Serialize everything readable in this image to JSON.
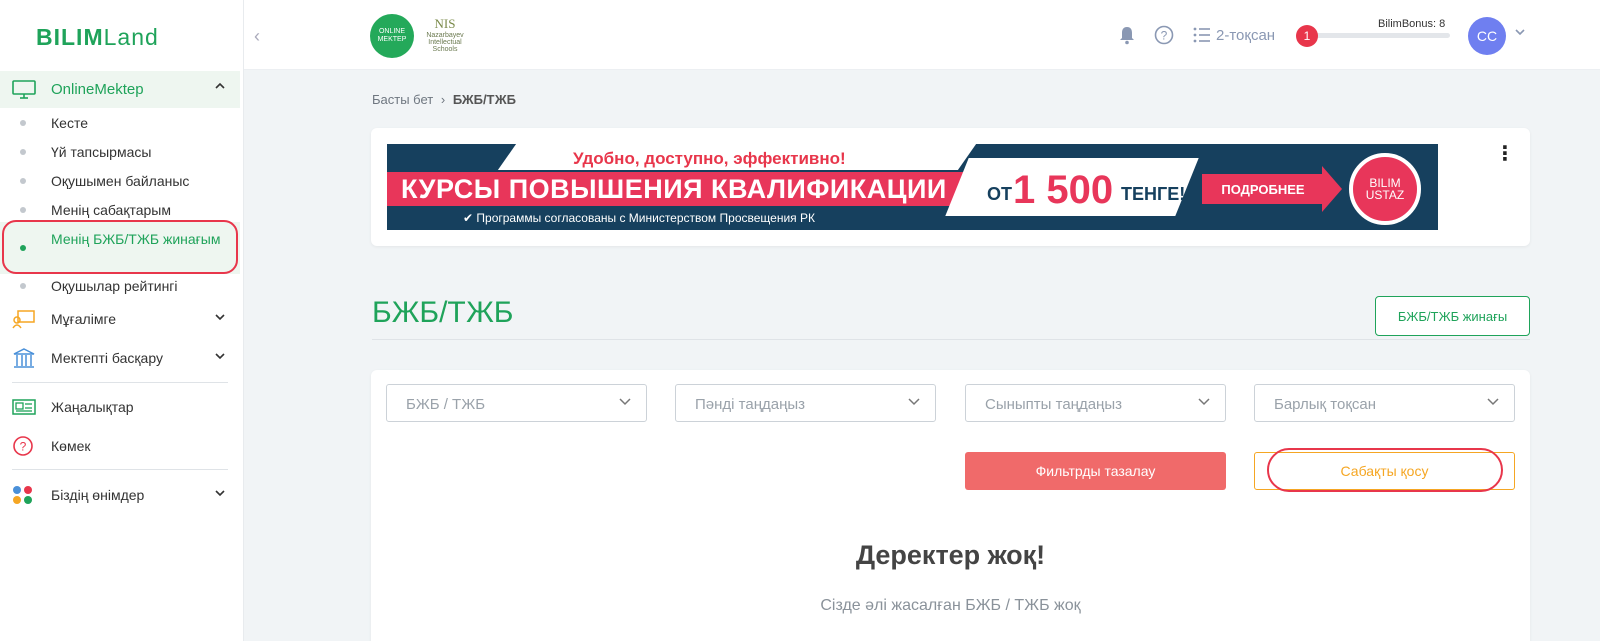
{
  "sidebar": {
    "logo_bold": "BILIM",
    "logo_thin": "Land",
    "collapse": "‹",
    "group_label": "OnlineMektep",
    "sub_items": [
      "Кесте",
      "Үй тапсырмасы",
      "Оқушымен байланыс",
      "Менің сабақтарым"
    ],
    "active_item": "Менің БЖБ/ТЖБ жинағым",
    "rating_item": "Оқушылар рейтингі",
    "teacher": "Мұғалімге",
    "manage": "Мектепті басқару",
    "news": "Жаңалықтар",
    "help": "Көмек",
    "products": "Біздің өнімдер"
  },
  "header": {
    "om_logo": "ONLINE MEKTEP",
    "nis_logo": "NIS",
    "nis_sub": "Nazarbayev Intellectual Schools",
    "quarter": "2-тоқсан",
    "bonus_label": "BilimBonus:",
    "bonus_value": "8",
    "bonus_badge": "1",
    "bonus_progress": 0,
    "avatar": "CC"
  },
  "breadcrumb": {
    "home": "Басты бет",
    "separator": "›",
    "current": "БЖБ/ТЖБ"
  },
  "banner": {
    "tagline": "Удобно, доступно, эффективно!",
    "headline": "КУРСЫ ПОВЫШЕНИЯ КВАЛИФИКАЦИИ",
    "price_from": "ОТ",
    "price": "1 500",
    "price_currency": "ТЕНГЕ!",
    "approve": "✔ Программы согласованы с Министерством Просвещения РК",
    "cta": "ПОДРОБНЕЕ",
    "brand": "BILIM USTAZ",
    "menu": "⋮"
  },
  "section": {
    "title": "БЖБ/ТЖБ",
    "collection_button": "БЖБ/ТЖБ жинағы"
  },
  "filters": {
    "type": "БЖБ / ТЖБ",
    "subject": "Пәнді таңдаңыз",
    "class": "Сыныпты таңдаңыз",
    "quarter": "Барлық тоқсан",
    "clear_button": "Фильтрды тазалау",
    "add_button": "Сабақты қосу"
  },
  "empty": {
    "title": "Деректер жоқ!",
    "subtitle": "Сізде әлі жасалған БЖБ / ТЖБ жоқ"
  },
  "colors": {
    "brand_green": "#1fa35a",
    "accent_red": "#e8364b",
    "clear_red": "#f06a6a",
    "add_orange": "#f5a623"
  }
}
